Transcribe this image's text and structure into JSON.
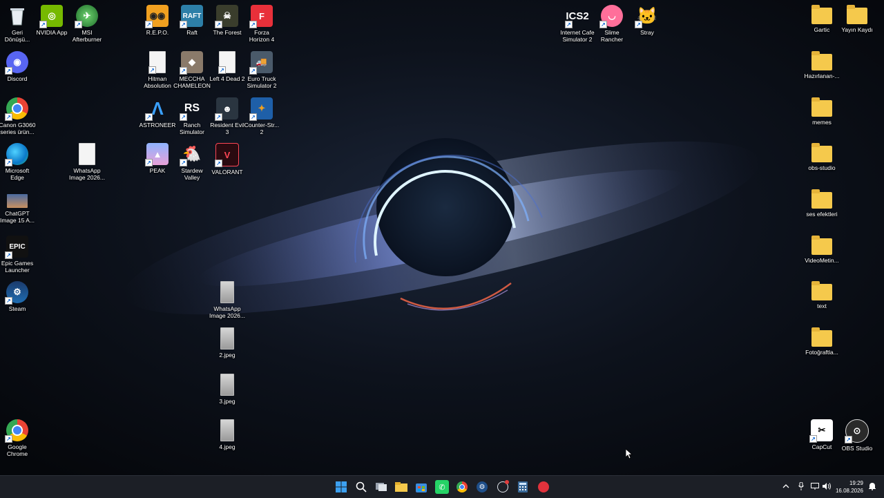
{
  "desktop": {
    "col1": [
      {
        "label": "Geri\nDönüşü...",
        "icon": "recycle-bin-icon"
      },
      {
        "label": "Discord",
        "icon": "discord-icon"
      },
      {
        "label": "Canon G3060\nseries ürün...",
        "icon": "chrome-icon"
      },
      {
        "label": "Microsoft\nEdge",
        "icon": "edge-icon"
      },
      {
        "label": "ChatGPT\nImage 15 A...",
        "icon": "image-icon"
      },
      {
        "label": "Epic Games\nLauncher",
        "icon": "epic-games-icon"
      },
      {
        "label": "Steam",
        "icon": "steam-icon"
      },
      {
        "label": "Google\nChrome",
        "icon": "chrome-icon"
      }
    ],
    "col2": [
      {
        "label": "NVIDIA App",
        "icon": "nvidia-icon"
      },
      {
        "label": "MSI\nAfterburner",
        "icon": "msi-afterburner-icon"
      },
      {
        "label": "WhatsApp\nImage 2026...",
        "icon": "document-icon"
      }
    ],
    "games": [
      {
        "label": "R.E.P.O.",
        "icon": "repo-icon"
      },
      {
        "label": "Raft",
        "icon": "raft-icon"
      },
      {
        "label": "The Forest",
        "icon": "the-forest-icon"
      },
      {
        "label": "Forza\nHorizon 4",
        "icon": "forza-icon"
      },
      {
        "label": "Hitman\nAbsolution",
        "icon": "document-icon"
      },
      {
        "label": "MECCHA\nCHAMELEON",
        "icon": "meccha-icon"
      },
      {
        "label": "Left 4 Dead 2",
        "icon": "document-icon"
      },
      {
        "label": "Euro Truck\nSimulator 2",
        "icon": "ets2-icon"
      },
      {
        "label": "ASTRONEER",
        "icon": "astroneer-icon"
      },
      {
        "label": "Ranch\nSimulator",
        "icon": "ranch-icon"
      },
      {
        "label": "Resident Evil\n3",
        "icon": "resident-evil-icon"
      },
      {
        "label": "Counter-Str...\n2",
        "icon": "counter-strike-icon"
      },
      {
        "label": "PEAK",
        "icon": "peak-icon"
      },
      {
        "label": "Stardew\nValley",
        "icon": "stardew-icon"
      },
      {
        "label": "VALORANT",
        "icon": "valorant-icon"
      }
    ],
    "files": [
      {
        "label": "WhatsApp\nImage 2026...",
        "icon": "photo-icon"
      },
      {
        "label": "2.jpeg",
        "icon": "photo-icon"
      },
      {
        "label": "3.jpeg",
        "icon": "photo-icon"
      },
      {
        "label": "4.jpeg",
        "icon": "photo-icon"
      }
    ],
    "top_right": [
      {
        "label": "Internet Cafe\nSimulator 2",
        "icon": "ics2-icon"
      },
      {
        "label": "Slime\nRancher",
        "icon": "slime-rancher-icon"
      },
      {
        "label": "Stray",
        "icon": "stray-icon"
      }
    ],
    "right_col": [
      {
        "label": "Gartic",
        "icon": "folder-icon"
      },
      {
        "label": "Hazırlanan-...",
        "icon": "folder-icon"
      },
      {
        "label": "memes",
        "icon": "folder-icon"
      },
      {
        "label": "obs-studio",
        "icon": "folder-icon"
      },
      {
        "label": "ses efektleri",
        "icon": "folder-icon"
      },
      {
        "label": "VideoMetin...",
        "icon": "folder-icon"
      },
      {
        "label": "text",
        "icon": "folder-icon"
      },
      {
        "label": "Fotoğraftla...",
        "icon": "folder-icon"
      },
      {
        "label": "CapCut",
        "icon": "capcut-icon"
      }
    ],
    "far_right": [
      {
        "label": "Yayın Kaydı",
        "icon": "folder-icon"
      },
      {
        "label": "OBS Studio",
        "icon": "obs-icon"
      }
    ]
  },
  "taskbar": {
    "apps": [
      "start-icon",
      "search-icon",
      "task-view-icon",
      "file-explorer-icon",
      "store-icon",
      "whatsapp-icon",
      "chrome-icon",
      "steam-icon",
      "clock-app-icon",
      "calculator-icon",
      "app-red-icon"
    ],
    "time": "19:29",
    "date": "16.08.2026"
  }
}
